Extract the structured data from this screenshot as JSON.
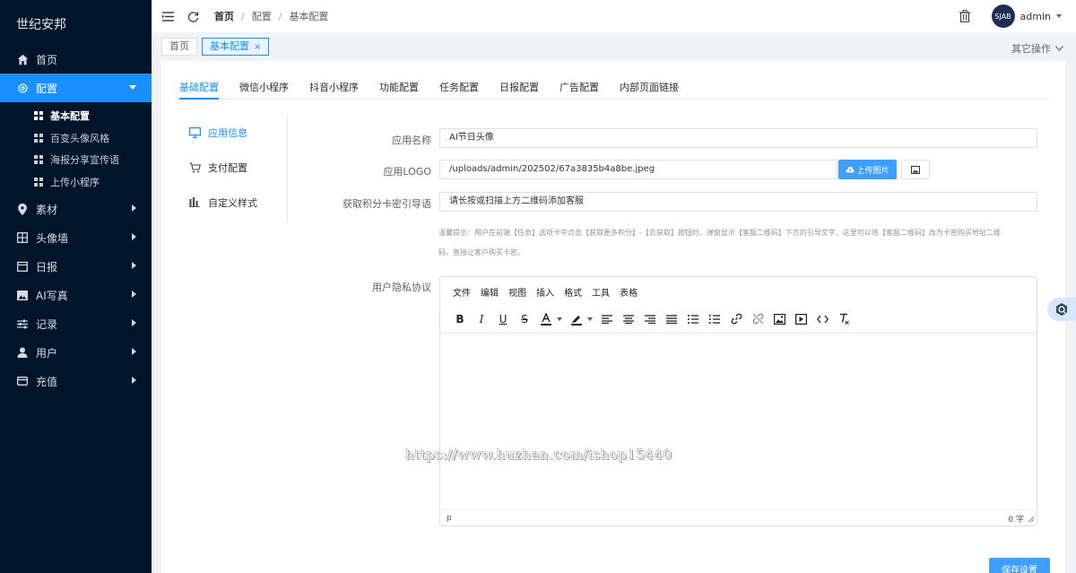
{
  "sidebar": {
    "brand": "世纪安邦",
    "menu": [
      {
        "label": "首页",
        "icon": "home-icon",
        "arrow": false
      },
      {
        "label": "配置",
        "icon": "settings-icon",
        "arrow": true,
        "active": true,
        "children": [
          {
            "label": "基本配置",
            "active": true
          },
          {
            "label": "百变头像风格"
          },
          {
            "label": "海报分享宣传语"
          },
          {
            "label": "上传小程序"
          }
        ]
      },
      {
        "label": "素材",
        "icon": "location-pin-icon",
        "arrow": true
      },
      {
        "label": "头像墙",
        "icon": "grid-icon",
        "arrow": true
      },
      {
        "label": "日报",
        "icon": "calendar-icon",
        "arrow": true
      },
      {
        "label": "AI写真",
        "icon": "image-icon",
        "arrow": true
      },
      {
        "label": "记录",
        "icon": "sliders-icon",
        "arrow": true
      },
      {
        "label": "用户",
        "icon": "user-icon",
        "arrow": true
      },
      {
        "label": "充值",
        "icon": "card-icon",
        "arrow": true
      }
    ]
  },
  "header": {
    "breadcrumb": [
      "首页",
      "配置",
      "基本配置"
    ],
    "username": "admin",
    "avatar_text": "SJAB"
  },
  "tagbar": {
    "tags": [
      "首页",
      "基本配置"
    ],
    "close_symbol": "×",
    "other_ops": "其它操作"
  },
  "tabs": [
    "基础配置",
    "微信小程序",
    "抖音小程序",
    "功能配置",
    "任务配置",
    "日报配置",
    "广告配置",
    "内部页面链接"
  ],
  "sidenav": [
    "应用信息",
    "支付配置",
    "自定义样式"
  ],
  "form": {
    "app_name_label": "应用名称",
    "app_name_value": "AI节日头像",
    "logo_label": "应用LOGO",
    "logo_value": "/uploads/admin/202502/67a3835b4a8be.jpeg",
    "upload_label": "上传图片",
    "guide_label": "获取积分卡密引导语",
    "guide_value": "请长按或扫描上方二维码添加客服",
    "tip_line1": "温馨提示：用户在前端【任务】选项卡中点击【获取更多积分】-【去获取】按钮时，弹窗显示【客服二维码】下方的引导文字，这里可以将【客服二维码】改为卡密购买地址二维",
    "tip_line2": "码，直接让客户购买卡密。",
    "privacy_label": "用户隐私协议"
  },
  "editor": {
    "menus": [
      "文件",
      "编辑",
      "视图",
      "插入",
      "格式",
      "工具",
      "表格"
    ],
    "status_path": "p",
    "word_count": "0 字"
  },
  "save_label": "保存设置",
  "watermark": "https://www.huzhan.com/ishop15440",
  "colors": {
    "primary": "#1890ff",
    "sidebar": "#001529",
    "button": "#409eff"
  }
}
